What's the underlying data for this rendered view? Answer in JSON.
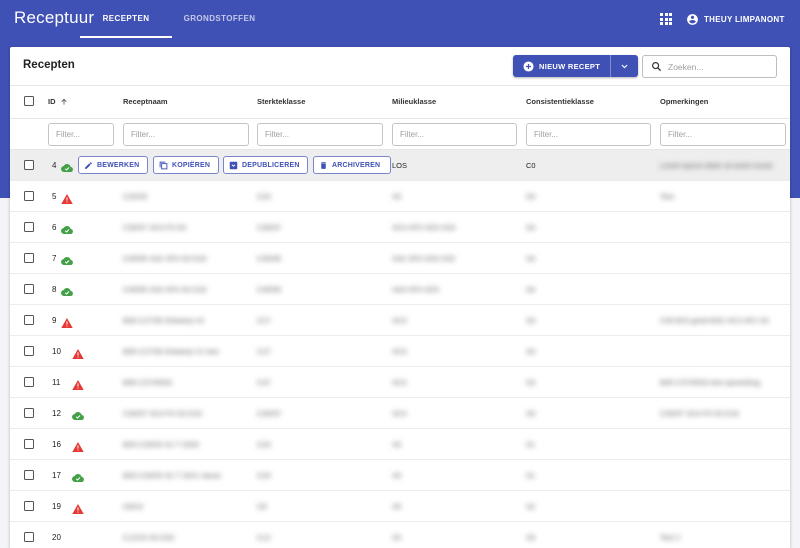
{
  "app": {
    "title": "Receptuur"
  },
  "nav": {
    "tabs": [
      {
        "label": "RECEPTEN",
        "active": true
      },
      {
        "label": "GRONDSTOFFEN",
        "active": false
      }
    ]
  },
  "user": {
    "name": "THEUY LIMPANONT",
    "icon": "account-circle-icon"
  },
  "page": {
    "title": "Recepten"
  },
  "toolbar": {
    "new_label": "NIEUW RECEPT",
    "search_placeholder": "Zoeken..."
  },
  "table": {
    "columns": [
      "ID",
      "Receptnaam",
      "Sterkteklasse",
      "Milieuklasse",
      "Consistentieklasse",
      "Opmerkingen"
    ],
    "filter_placeholder": "Filter...",
    "row_actions": [
      "BEWERKEN",
      "KOPIËREN",
      "DEPUBLICEREN",
      "ARCHIVEREN"
    ],
    "rows": [
      {
        "id": "4",
        "status": "published",
        "name": "",
        "strength": "",
        "environment": "LOS",
        "consistency": "C0",
        "remarks": "Lorem ipsum dolor sit amet conse",
        "selected": true
      },
      {
        "id": "5",
        "status": "warning",
        "name": "C20/25",
        "strength": "C20",
        "environment": "X0",
        "consistency": "S3",
        "remarks": "Test",
        "selected": false
      },
      {
        "id": "6",
        "status": "published",
        "name": "C30/37 XC4 F3 S3",
        "strength": "C30/37",
        "environment": "XC4 XF3 XD3 XS3",
        "consistency": "S3",
        "remarks": "",
        "selected": false
      },
      {
        "id": "7",
        "status": "published",
        "name": "C35/45 XA2 XF4 S3 D16",
        "strength": "C35/45",
        "environment": "XA2 XF4 XD3 XS3",
        "consistency": "S4",
        "remarks": "",
        "selected": false
      },
      {
        "id": "8",
        "status": "published",
        "name": "C45/55 XA3 XF4 S4 D16",
        "strength": "C45/55",
        "environment": "XA3 XF4 XD3",
        "consistency": "S4",
        "remarks": "",
        "selected": false
      },
      {
        "id": "9",
        "status": "warning",
        "name": "B35 C27/35 Ontwerp V2",
        "strength": "C27",
        "environment": "XC3",
        "consistency": "S3",
        "remarks": "C35 B15 grind 8/32 XC3 XF2 S3",
        "selected": false
      },
      {
        "id": "10",
        "status": "warning",
        "name": "B35 C27/35 Ontwerp V1 test",
        "strength": "C27",
        "environment": "XC3",
        "consistency": "S3",
        "remarks": "",
        "selected": false
      },
      {
        "id": "11",
        "status": "warning",
        "name": "B45 C37/45S3",
        "strength": "C37",
        "environment": "XC4",
        "consistency": "S3",
        "remarks": "B45 C37/45S3 test opmerking",
        "selected": false
      },
      {
        "id": "12",
        "status": "published",
        "name": "C30/37 XC4 F3 S3 D16",
        "strength": "C30/37",
        "environment": "XC4",
        "consistency": "S3",
        "remarks": "C30/37 XC4 F3 S3 D16",
        "selected": false
      },
      {
        "id": "16",
        "status": "warning",
        "name": "B25 C20/25 S1 T 2020",
        "strength": "C20",
        "environment": "X0",
        "consistency": "S1",
        "remarks": "",
        "selected": false
      },
      {
        "id": "17",
        "status": "published",
        "name": "B25 C20/25 S1 T 2021 nieuw",
        "strength": "C20",
        "environment": "X0",
        "consistency": "S1",
        "remarks": "",
        "selected": false
      },
      {
        "id": "19",
        "status": "warning",
        "name": "C8/10",
        "strength": "C8",
        "environment": "X0",
        "consistency": "S2",
        "remarks": "",
        "selected": false
      },
      {
        "id": "20",
        "status": "none",
        "name": "C12/15 S3 D32",
        "strength": "C12",
        "environment": "X0",
        "consistency": "S3",
        "remarks": "Test 2",
        "selected": false
      }
    ]
  },
  "colors": {
    "primary": "#3f51b5",
    "published": "#43a047",
    "warning": "#e53935"
  }
}
